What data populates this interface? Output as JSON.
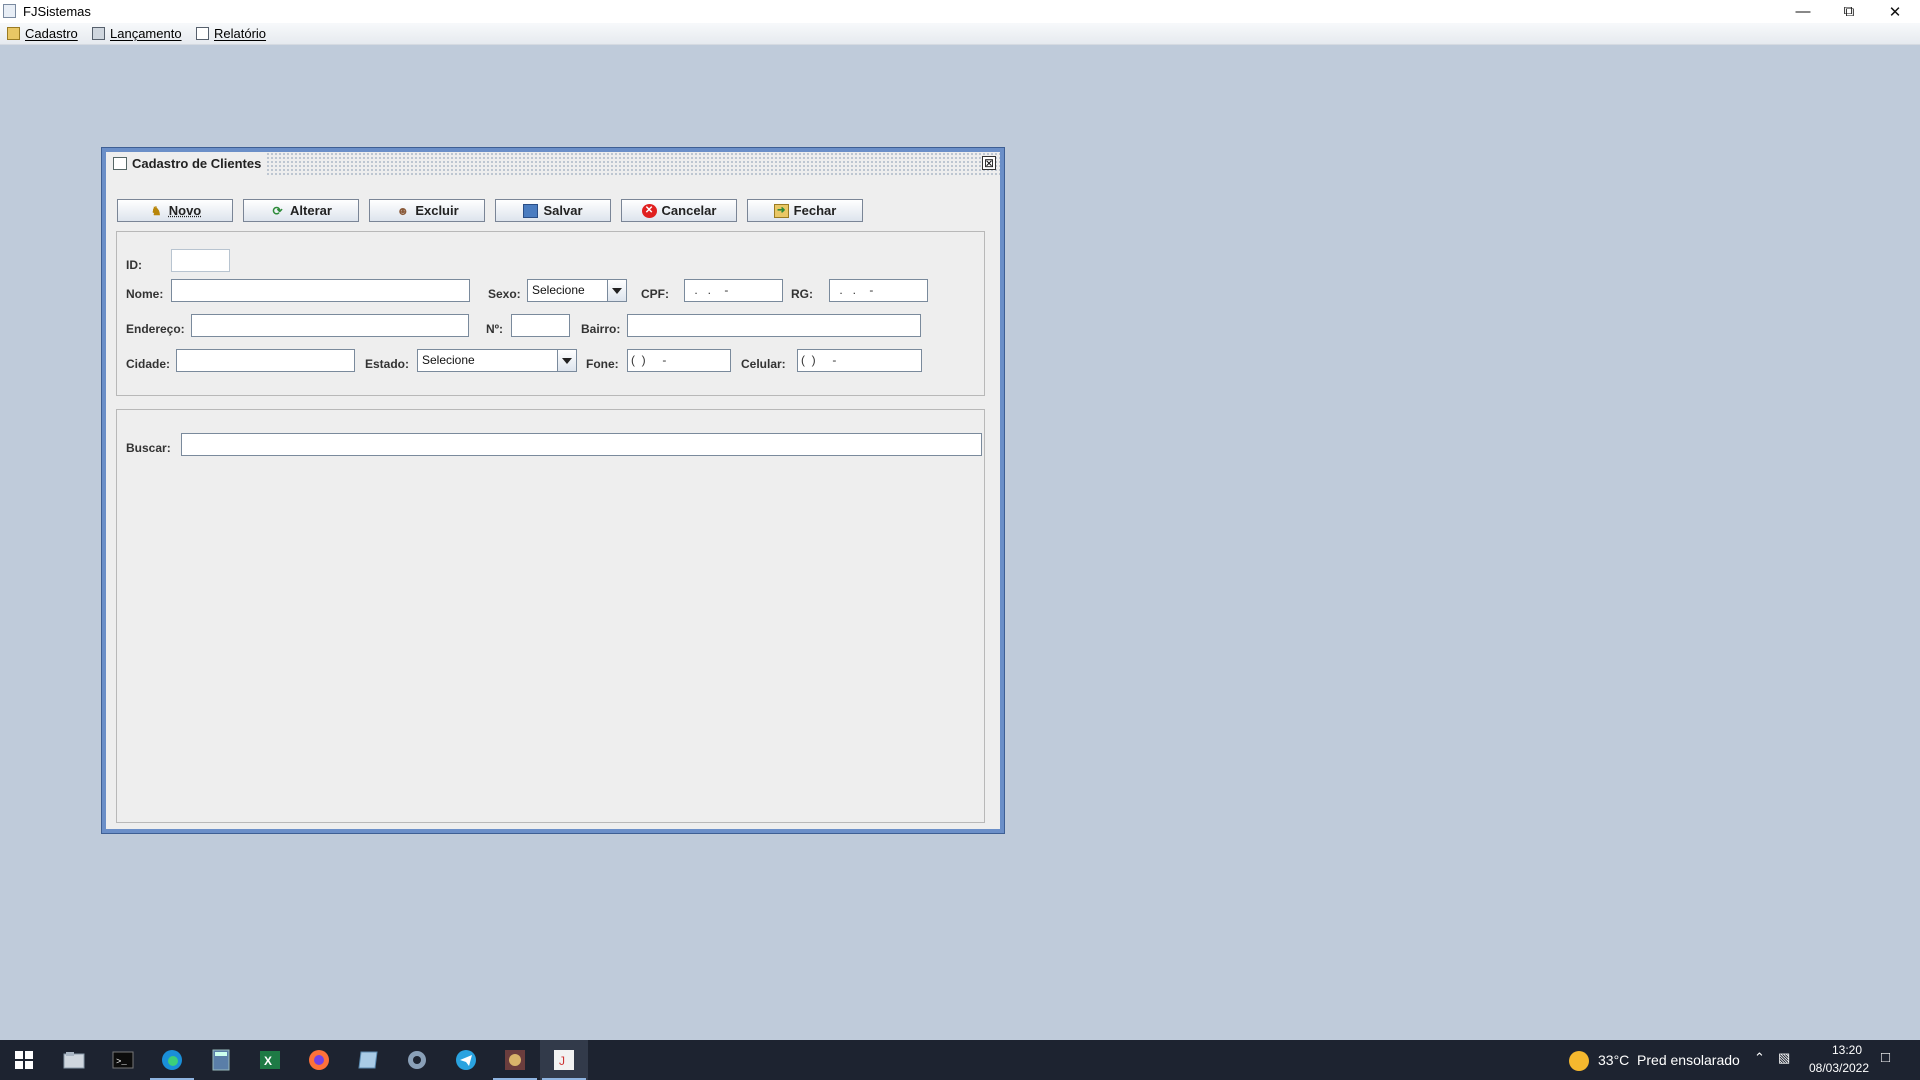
{
  "window": {
    "title": "FJSistemas",
    "controls": [
      "minimize-icon",
      "restore-icon",
      "close-icon"
    ]
  },
  "menubar": {
    "items": [
      {
        "label": "Cadastro",
        "icon": "folder-icon"
      },
      {
        "label": "Lançamento",
        "icon": "calculator-icon"
      },
      {
        "label": "Relatório",
        "icon": "report-icon"
      }
    ]
  },
  "frame": {
    "title": "Cadastro de Clientes",
    "close_glyph": "⊠",
    "toolbar": [
      {
        "label": "Novo",
        "icon": "new-user-icon"
      },
      {
        "label": "Alterar",
        "icon": "refresh-icon"
      },
      {
        "label": "Excluir",
        "icon": "delete-user-icon"
      },
      {
        "label": "Salvar",
        "icon": "save-icon"
      },
      {
        "label": "Cancelar",
        "icon": "cancel-icon"
      },
      {
        "label": "Fechar",
        "icon": "exit-icon"
      }
    ],
    "form": {
      "id_label": "ID:",
      "id_value": "",
      "nome_label": "Nome:",
      "nome_value": "",
      "sexo_label": "Sexo:",
      "sexo_value": "Selecione",
      "cpf_label": "CPF:",
      "cpf_mask": " .   .    -",
      "rg_label": "RG:",
      "rg_mask": " .   .    -",
      "endereco_label": "Endereço:",
      "endereco_value": "",
      "numero_label": "Nº:",
      "numero_value": "",
      "bairro_label": "Bairro:",
      "bairro_value": "",
      "cidade_label": "Cidade:",
      "cidade_value": "",
      "estado_label": "Estado:",
      "estado_value": "Selecione",
      "fone_label": "Fone:",
      "fone_mask": "(  )     -",
      "celular_label": "Celular:",
      "celular_mask": "(  )     -"
    },
    "search": {
      "label": "Buscar:",
      "value": ""
    }
  },
  "taskbar": {
    "apps": [
      "windows-start-icon",
      "file-explorer-icon",
      "terminal-icon",
      "edge-icon",
      "calculator-icon",
      "excel-icon",
      "firefox-icon",
      "notepad-icon",
      "settings-icon",
      "telegram-icon",
      "db-tool-icon",
      "java-app-icon"
    ],
    "weather": "33°C  Pred ensolarado",
    "time": "13:20",
    "date": "08/03/2022"
  }
}
